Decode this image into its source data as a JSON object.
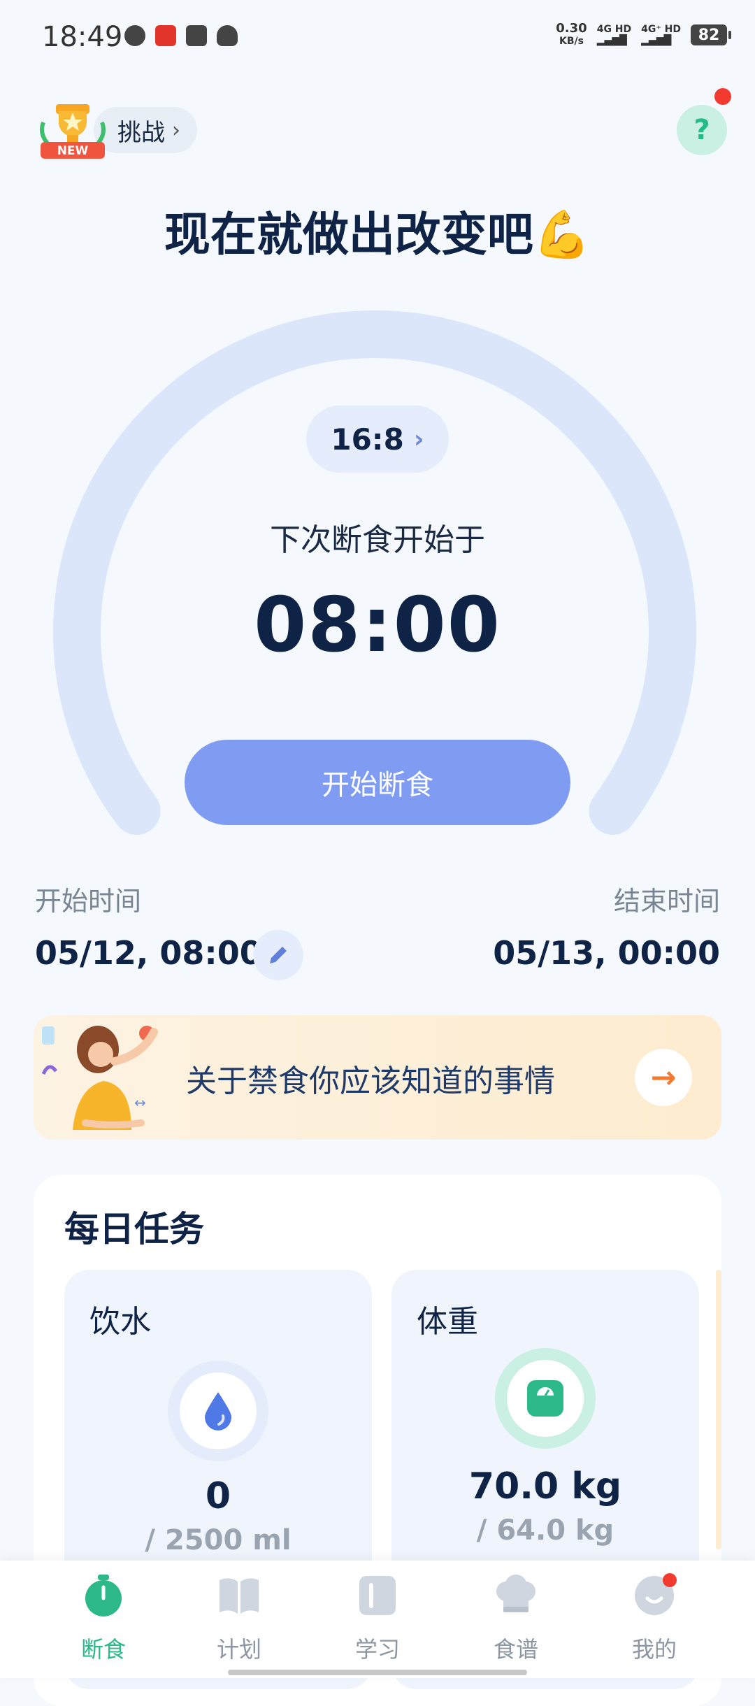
{
  "status_bar": {
    "time": "18:49",
    "net_speed_value": "0.30",
    "net_speed_unit": "KB/s",
    "sim1": "4G HD",
    "sim2": "4G⁺ HD",
    "battery": "82"
  },
  "header": {
    "challenge_badge": "NEW",
    "challenge_label": "挑战",
    "help_symbol": "?",
    "headline": "现在就做出改变吧💪"
  },
  "fasting": {
    "plan_ratio": "16:8",
    "next_label": "下次断食开始于",
    "next_time": "08:00",
    "start_button": "开始断食",
    "start_time_label": "开始时间",
    "start_time_value": "05/12, 08:00",
    "end_time_label": "结束时间",
    "end_time_value": "05/13, 00:00"
  },
  "banner": {
    "text": "关于禁食你应该知道的事情"
  },
  "daily_tasks": {
    "title": "每日任务",
    "water": {
      "title": "饮水",
      "value": "0",
      "target": "/ 2500 ml"
    },
    "weight": {
      "title": "体重",
      "value": "70.0 kg",
      "target": "/ 64.0 kg"
    }
  },
  "nav": {
    "items": [
      {
        "label": "断食",
        "icon": "stopwatch-icon",
        "active": true
      },
      {
        "label": "计划",
        "icon": "book-icon",
        "active": false
      },
      {
        "label": "学习",
        "icon": "notebook-icon",
        "active": false
      },
      {
        "label": "食谱",
        "icon": "chef-hat-icon",
        "active": false
      },
      {
        "label": "我的",
        "icon": "profile-icon",
        "active": false
      }
    ]
  },
  "colors": {
    "accent_green": "#2db889",
    "button_blue": "#7f9cf2",
    "gauge_track": "#dbe6fb",
    "dark_text": "#0f2347"
  }
}
